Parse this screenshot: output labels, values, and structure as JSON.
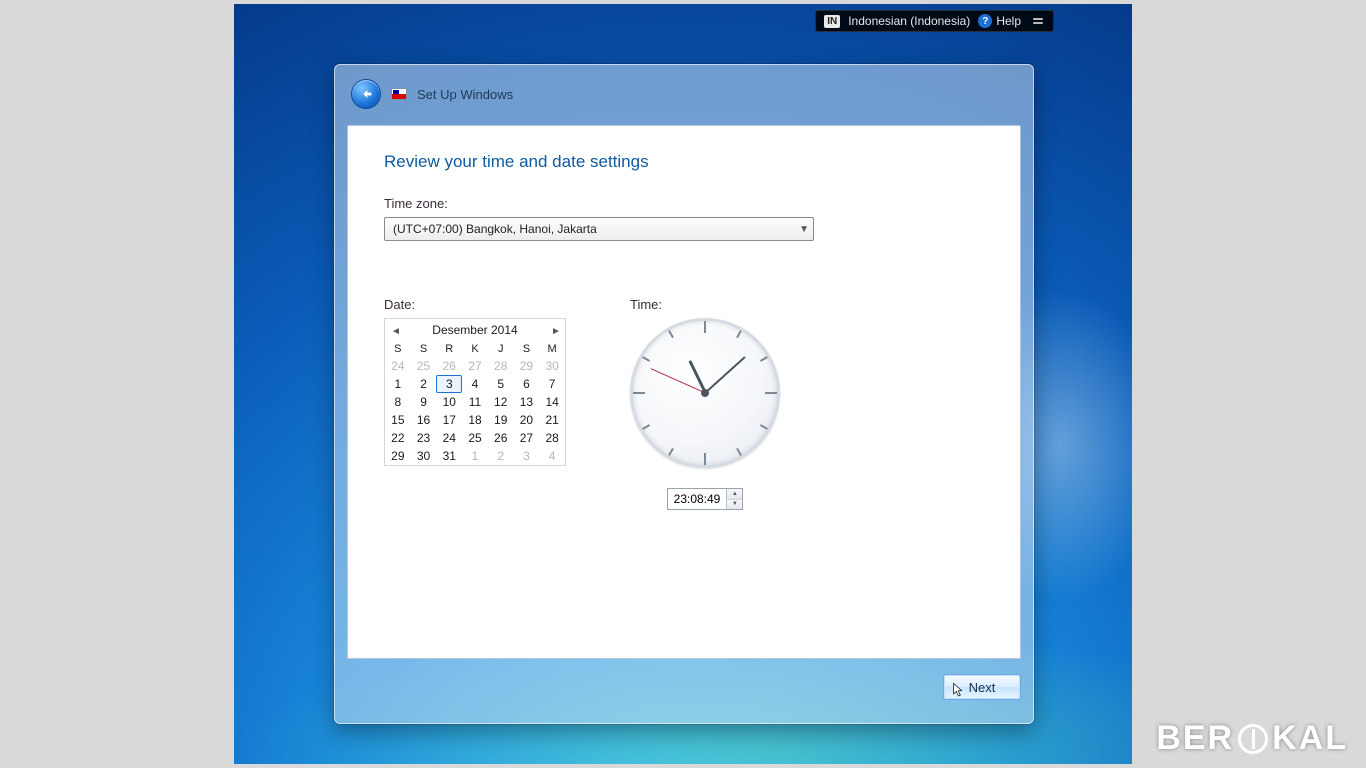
{
  "lang_bar": {
    "code": "IN",
    "name": "Indonesian (Indonesia)",
    "help": "Help"
  },
  "window": {
    "title": "Set Up Windows"
  },
  "page": {
    "heading": "Review your time and date settings",
    "tz_label": "Time zone:",
    "tz_value": "(UTC+07:00) Bangkok, Hanoi, Jakarta",
    "date_label": "Date:",
    "time_label": "Time:"
  },
  "calendar": {
    "month_label": "Desember 2014",
    "dow": [
      "S",
      "S",
      "R",
      "K",
      "J",
      "S",
      "M"
    ],
    "leading_out": [
      "24",
      "25",
      "26",
      "27",
      "28",
      "29",
      "30"
    ],
    "days": [
      "1",
      "2",
      "3",
      "4",
      "5",
      "6",
      "7",
      "8",
      "9",
      "10",
      "11",
      "12",
      "13",
      "14",
      "15",
      "16",
      "17",
      "18",
      "19",
      "20",
      "21",
      "22",
      "23",
      "24",
      "25",
      "26",
      "27",
      "28",
      "29",
      "30",
      "31"
    ],
    "trailing_out": [
      "1",
      "2",
      "3",
      "4"
    ],
    "selected": "3"
  },
  "time": {
    "value": "23:08:49",
    "hour": 23,
    "minute": 8,
    "second": 49
  },
  "footer": {
    "next": "Next"
  },
  "watermark": {
    "pre": "BER",
    "post": "KAL"
  }
}
